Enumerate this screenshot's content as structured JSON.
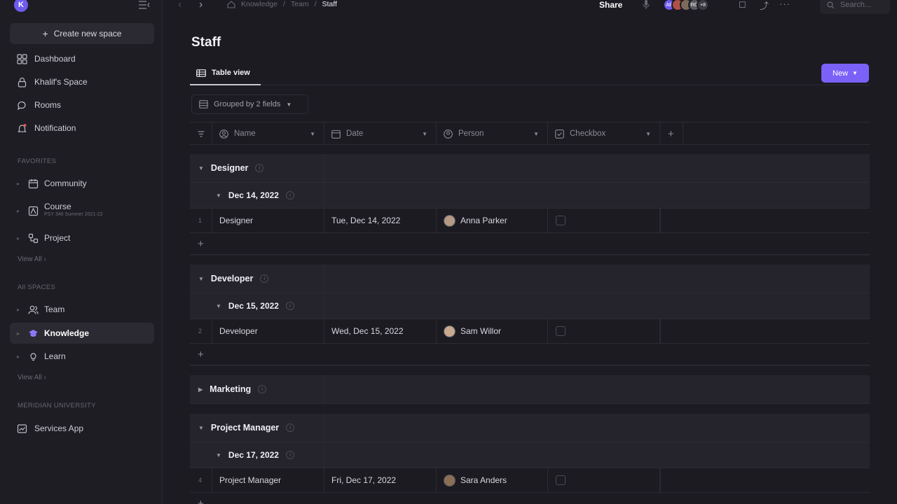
{
  "sidebar": {
    "avatar_letter": "K",
    "create_label": "Create new space",
    "nav": [
      {
        "label": "Dashboard",
        "icon": "grid-icon"
      },
      {
        "label": "Khalif's Space",
        "icon": "lock-icon"
      },
      {
        "label": "Rooms",
        "icon": "chat-icon"
      },
      {
        "label": "Notification",
        "icon": "bell-icon"
      }
    ],
    "favorites_label": "FAVORITES",
    "favorites": [
      {
        "label": "Community",
        "icon": "calendar-icon"
      },
      {
        "label": "Course",
        "sub": "PSY 346 Summer 2021-22",
        "icon": "course-icon"
      },
      {
        "label": "Project",
        "icon": "project-icon"
      }
    ],
    "view_all_1": "View All",
    "all_spaces_label": "All SPACES",
    "spaces": [
      {
        "label": "Team",
        "icon": "team-icon"
      },
      {
        "label": "Knowledge",
        "icon": "graduation-icon"
      },
      {
        "label": "Learn",
        "icon": "bulb-icon"
      }
    ],
    "view_all_2": "View All",
    "university_label": "MERIDIAN UNIVERSITY",
    "services_label": "Services App"
  },
  "topbar": {
    "crumbs": [
      "Knowledge",
      "Team",
      "Staff"
    ],
    "share_label": "Share",
    "avatars": [
      "AB",
      "",
      "",
      "RO",
      "+8"
    ],
    "search_placeholder": "Search..."
  },
  "page": {
    "title": "Staff",
    "tab_label": "Table view",
    "new_label": "New",
    "group_label": "Grouped by 2 fields"
  },
  "table": {
    "columns": [
      {
        "label": "Name",
        "icon": "name-icon"
      },
      {
        "label": "Date",
        "icon": "calendar-icon"
      },
      {
        "label": "Person",
        "icon": "person-icon"
      },
      {
        "label": "Checkbox",
        "icon": "checkbox-icon"
      }
    ],
    "groups": [
      {
        "name": "Designer",
        "date": "Dec 14, 2022",
        "row": {
          "num": "1",
          "name": "Designer",
          "date": "Tue, Dec 14, 2022",
          "person": "Anna Parker",
          "color": "#b49a84"
        }
      },
      {
        "name": "Developer",
        "date": "Dec 15, 2022",
        "row": {
          "num": "2",
          "name": "Developer",
          "date": "Wed, Dec 15, 2022",
          "person": "Sam Willor",
          "color": "#c7a98e"
        }
      },
      {
        "name": "Marketing"
      },
      {
        "name": "Project Manager",
        "date": "Dec 17, 2022",
        "row": {
          "num": "4",
          "name": "Project Manager",
          "date": "Fri, Dec 17, 2022",
          "person": "Sara Anders",
          "color": "#8a6f55"
        }
      }
    ]
  },
  "colors": {
    "accent": "#7b61f8",
    "background": "#1c1b22",
    "sidebar": "#1e1d24"
  }
}
